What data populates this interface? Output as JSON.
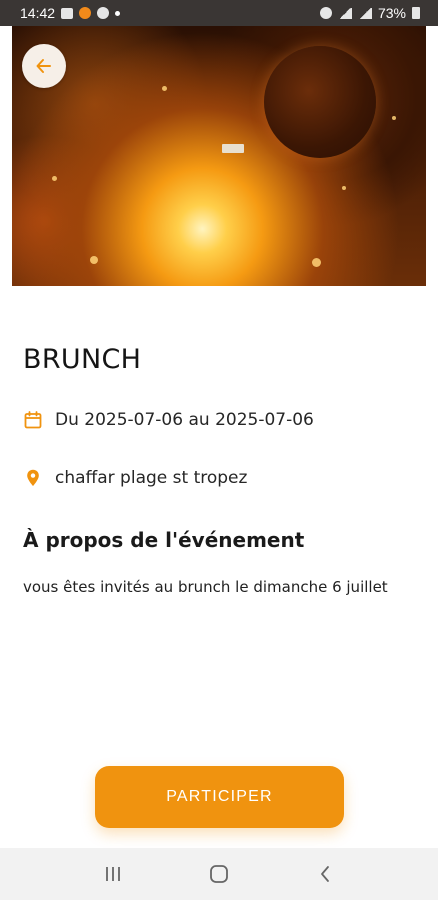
{
  "status_bar": {
    "time": "14:42",
    "battery": "73%"
  },
  "hero": {
    "back_icon": "arrow-left-icon"
  },
  "event": {
    "title": "BRUNCH",
    "date_range": "Du 2025-07-06 au 2025-07-06",
    "location": "chaffar plage st tropez",
    "about_title": "À propos de l'événement",
    "description": "vous êtes invités au brunch le dimanche 6 juillet"
  },
  "actions": {
    "participate_label": "PARTICIPER"
  },
  "colors": {
    "accent": "#f0930f",
    "icon_accent": "#f0930f"
  },
  "nav": {
    "recents_icon": "recents-icon",
    "home_icon": "home-icon",
    "back_icon": "back-icon"
  }
}
